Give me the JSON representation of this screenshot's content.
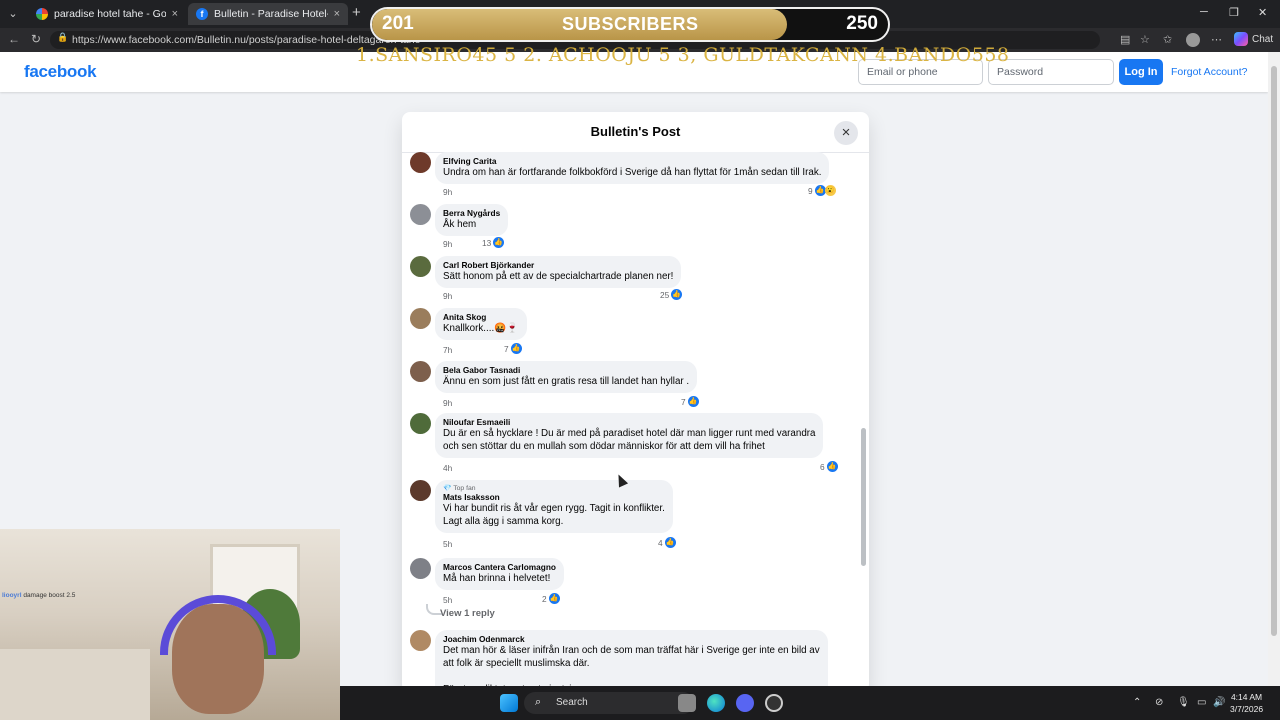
{
  "browser": {
    "tabs": [
      {
        "title": "paradise hotel tahe - Google Search",
        "close": "×"
      },
      {
        "title": "Bulletin - Paradise Hotel-deltagaren tahe",
        "close": "×"
      }
    ],
    "new_tab": "+",
    "url": "https://www.facebook.com/Bulletin.nu/posts/paradise-hotel-deltagaren-tahe",
    "copilot_label": "Chat"
  },
  "overlay": {
    "subscribers_current": "201",
    "subscribers_label": "SUBSCRIBERS",
    "subscribers_goal": "250",
    "progress_fraction": 0.804,
    "leaderboard": "1.SANSIRO45 5 2. ACHOOJU 5  3, GULDTAKCANN  4.BANDO558"
  },
  "facebook": {
    "logo": "facebook",
    "email_placeholder": "Email or phone",
    "password_placeholder": "Password",
    "login_label": "Log In",
    "forgot_label": "Forgot Account?",
    "dialog_title": "Bulletin's Post",
    "close_icon": "×",
    "comments": [
      {
        "author": "Elfving Carita",
        "text": "Undra om han är fortfarande folkbokförd i Sverige då han flyttat för 1mån sedan till Irak.",
        "time": "9h",
        "likes": "9",
        "wow": true
      },
      {
        "author": "Berra Nygårds",
        "text": "Åk hem",
        "time": "9h",
        "likes": "13"
      },
      {
        "author": "Carl Robert Björkander",
        "text": "Sätt honom på ett av de specialchartrade planen ner!",
        "time": "9h",
        "likes": "25"
      },
      {
        "author": "Anita Skog",
        "text": "Knallkork....🤬🍷",
        "time": "7h",
        "likes": "7"
      },
      {
        "author": "Bela Gabor Tasnadi",
        "text": "Ännu en som just fått en gratis resa till landet han hyllar .",
        "time": "9h",
        "likes": "7"
      },
      {
        "author": "Niloufar Esmaeili",
        "text": "Du är en så hycklare ! Du är med på paradiset hotel där man ligger runt med varandra\noch sen stöttar du en mullah som dödar människor för att dem vill ha frihet",
        "time": "4h",
        "likes": "6"
      },
      {
        "author": "Mats Isaksson",
        "badge": "Top fan",
        "text": "Vi har bundit ris åt vår egen rygg. Tagit in konflikter.\nLagt alla ägg i samma korg.",
        "time": "5h",
        "likes": "4"
      },
      {
        "author": "Marcos Cantera Carlomagno",
        "text": "Må han brinna i helvetet!",
        "time": "5h",
        "likes": "2"
      },
      {
        "author": "Joachim Odenmarck",
        "text": "Det man hör & läser inifrån Iran och de som man träffat här i Sverige ger inte en bild av\natt folk är speciellt muslimska där.\n\nFörutom diktatur styret givetvis.",
        "time": "",
        "likes": ""
      }
    ],
    "view_reply": "View 1 reply"
  },
  "webcam": {
    "chat_user": "liooyrl",
    "chat_text": "damage boost 2.5"
  },
  "taskbar": {
    "search_label": "Search",
    "time": "4:14 AM",
    "date": "3/7/2026"
  },
  "icons": [
    "search-icon",
    "edge-icon",
    "discord-icon",
    "obs-icon",
    "start-icon",
    "like-icon",
    "wow-icon"
  ]
}
